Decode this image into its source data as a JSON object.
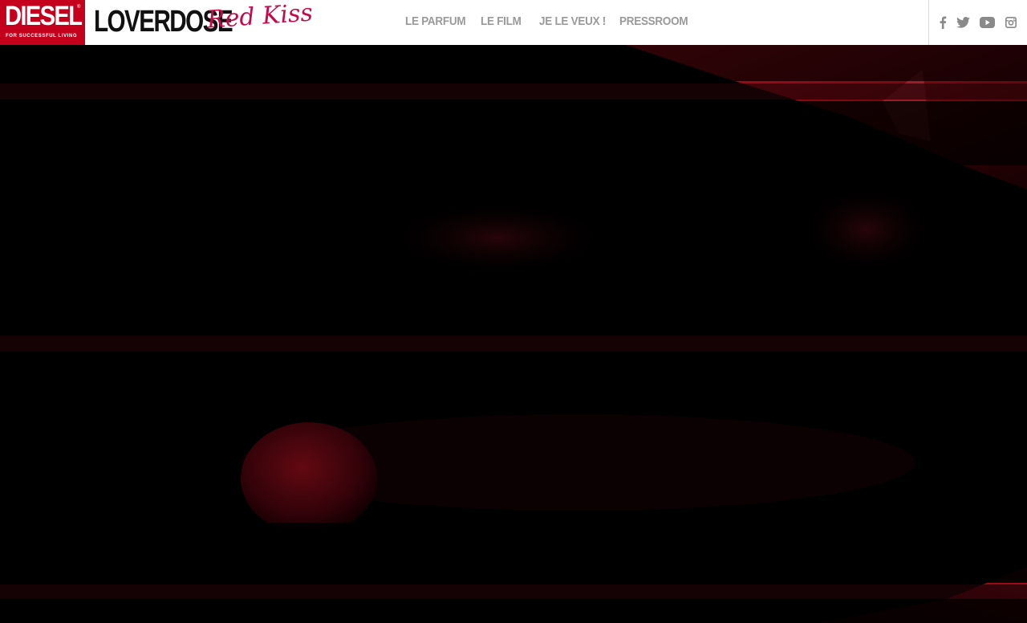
{
  "brand": {
    "logo_word": "DIESEL",
    "logo_tagline": "FOR SUCCESSFUL LIVING",
    "product": "LOVERDOSE",
    "edition": "Red Kiss"
  },
  "nav": {
    "items": [
      {
        "label": "LE PARFUM"
      },
      {
        "label": "LE FILM"
      },
      {
        "label": "JE LE VEUX !"
      },
      {
        "label": "PRESSROOM"
      }
    ]
  },
  "social": [
    {
      "icon": "facebook-icon"
    },
    {
      "icon": "twitter-icon"
    },
    {
      "icon": "youtube-icon"
    },
    {
      "icon": "instagram-icon"
    }
  ],
  "colors": {
    "brand_red": "#c4001d",
    "accent_pink": "#c40a4a",
    "nav_gray": "#9a9a9a",
    "hero_red": "#8a0a14"
  }
}
